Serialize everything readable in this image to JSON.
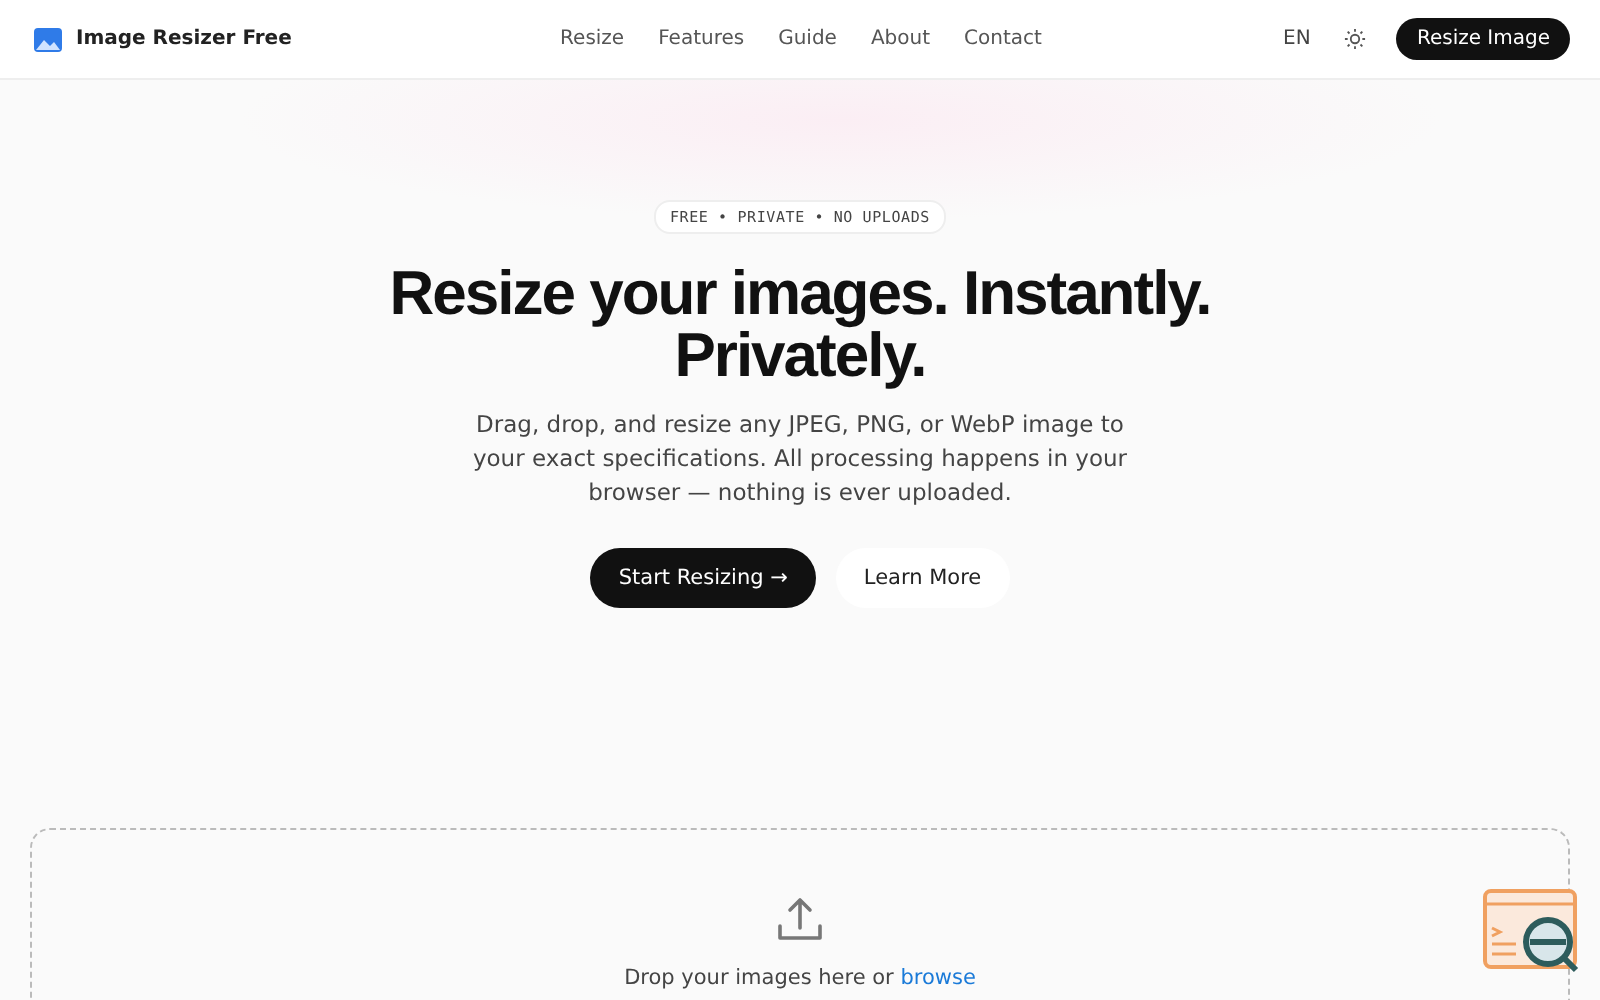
{
  "header": {
    "brand": "Image Resizer Free",
    "nav": [
      "Resize",
      "Features",
      "Guide",
      "About",
      "Contact"
    ],
    "language": "EN",
    "cta": "Resize Image"
  },
  "hero": {
    "badge": "FREE • PRIVATE • NO UPLOADS",
    "title_lines": [
      "Resize your images. Instantly.",
      "Privately."
    ],
    "description": "Drag, drop, and resize any JPEG, PNG, or WebP image to your exact specifications. All processing happens in your browser — nothing is ever uploaded.",
    "primary_button": "Start Resizing →",
    "secondary_button": "Learn More"
  },
  "dropzone": {
    "prompt": "Drop your images here or",
    "link": "browse"
  }
}
